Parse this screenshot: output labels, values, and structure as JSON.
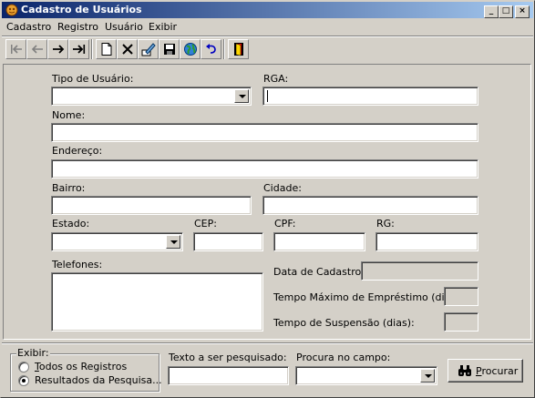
{
  "window": {
    "title": "Cadastro de Usuários",
    "minimize": "_",
    "maximize": "□",
    "close": "×"
  },
  "menu": [
    "Cadastro",
    "Registro",
    "Usuário",
    "Exibir"
  ],
  "toolbar": {
    "icons": [
      "first-record-icon",
      "previous-record-icon",
      "next-record-icon",
      "last-record-icon",
      "new-document-icon",
      "delete-icon",
      "edit-icon",
      "save-icon",
      "globe-icon",
      "undo-icon",
      "exit-door-icon"
    ]
  },
  "form": {
    "tipo_usuario": {
      "label": "Tipo de Usuário:",
      "value": ""
    },
    "rga": {
      "label": "RGA:",
      "value": ""
    },
    "nome": {
      "label": "Nome:",
      "value": ""
    },
    "endereco": {
      "label": "Endereço:",
      "value": ""
    },
    "bairro": {
      "label": "Bairro:",
      "value": ""
    },
    "cidade": {
      "label": "Cidade:",
      "value": ""
    },
    "estado": {
      "label": "Estado:",
      "value": ""
    },
    "cep": {
      "label": "CEP:",
      "value": ""
    },
    "cpf": {
      "label": "CPF:",
      "value": ""
    },
    "rg": {
      "label": "RG:",
      "value": ""
    },
    "telefones": {
      "label": "Telefones:",
      "value": ""
    },
    "data_cadastro": {
      "label": "Data de Cadastro:",
      "value": ""
    },
    "tempo_max_emprestimo": {
      "label": "Tempo Máximo de Empréstimo (dias):",
      "value": ""
    },
    "tempo_suspensao": {
      "label": "Tempo de Suspensão (dias):",
      "value": ""
    }
  },
  "search": {
    "exibir_caption": "Exibir:",
    "radio_todos": {
      "first": "T",
      "rest": "odos os Registros",
      "selected": false
    },
    "radio_resultados": {
      "label": "Resultados da Pesquisa...",
      "selected": true
    },
    "texto_label": "Texto a ser pesquisado:",
    "texto_value": "",
    "campo_label": "Procura no campo:",
    "campo_value": "",
    "procurar_first": "P",
    "procurar_rest": "rocurar"
  },
  "colors": {
    "face": "#d4d0c8",
    "title_start": "#0a246a",
    "title_end": "#a6caf0"
  }
}
